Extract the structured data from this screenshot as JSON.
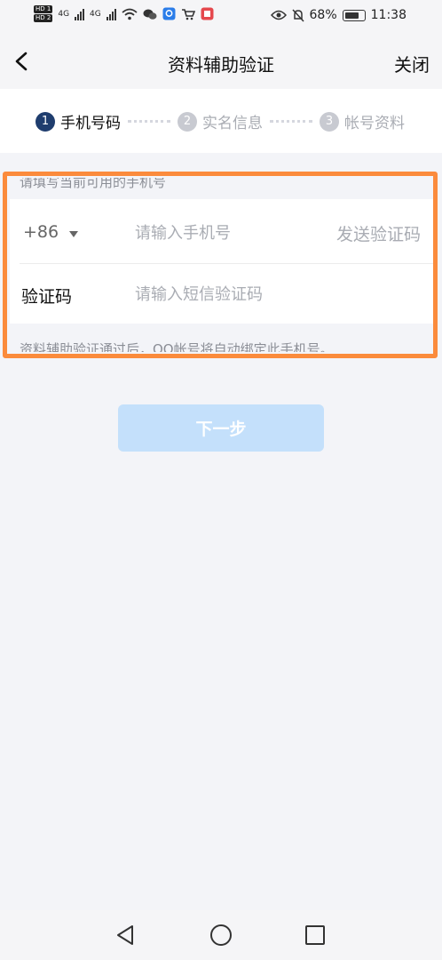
{
  "status_bar": {
    "sim1": "HD 1",
    "sim2": "HD 2",
    "net1": "4G",
    "net2": "4G",
    "battery": "68%",
    "time": "11:38"
  },
  "header": {
    "title": "资料辅助验证",
    "close_label": "关闭"
  },
  "steps": [
    {
      "num": "1",
      "label": "手机号码"
    },
    {
      "num": "2",
      "label": "实名信息"
    },
    {
      "num": "3",
      "label": "帐号资料"
    }
  ],
  "form": {
    "hint_top": "请填写当前可用的手机号",
    "country_code": "+86",
    "phone_placeholder": "请输入手机号",
    "send_code": "发送验证码",
    "code_label": "验证码",
    "code_placeholder": "请输入短信验证码",
    "hint_bottom": "资料辅助验证通过后，QQ帐号将自动绑定此手机号。"
  },
  "next_button": "下一步",
  "colors": {
    "active_step": "#1f3d6e",
    "inactive_step": "#c8cad1",
    "highlight": "#fb8b3c",
    "button": "#c4e0fb"
  },
  "system_nav": {
    "back": "back-triangle-icon",
    "home": "home-circle-icon",
    "recent": "recent-square-icon"
  }
}
